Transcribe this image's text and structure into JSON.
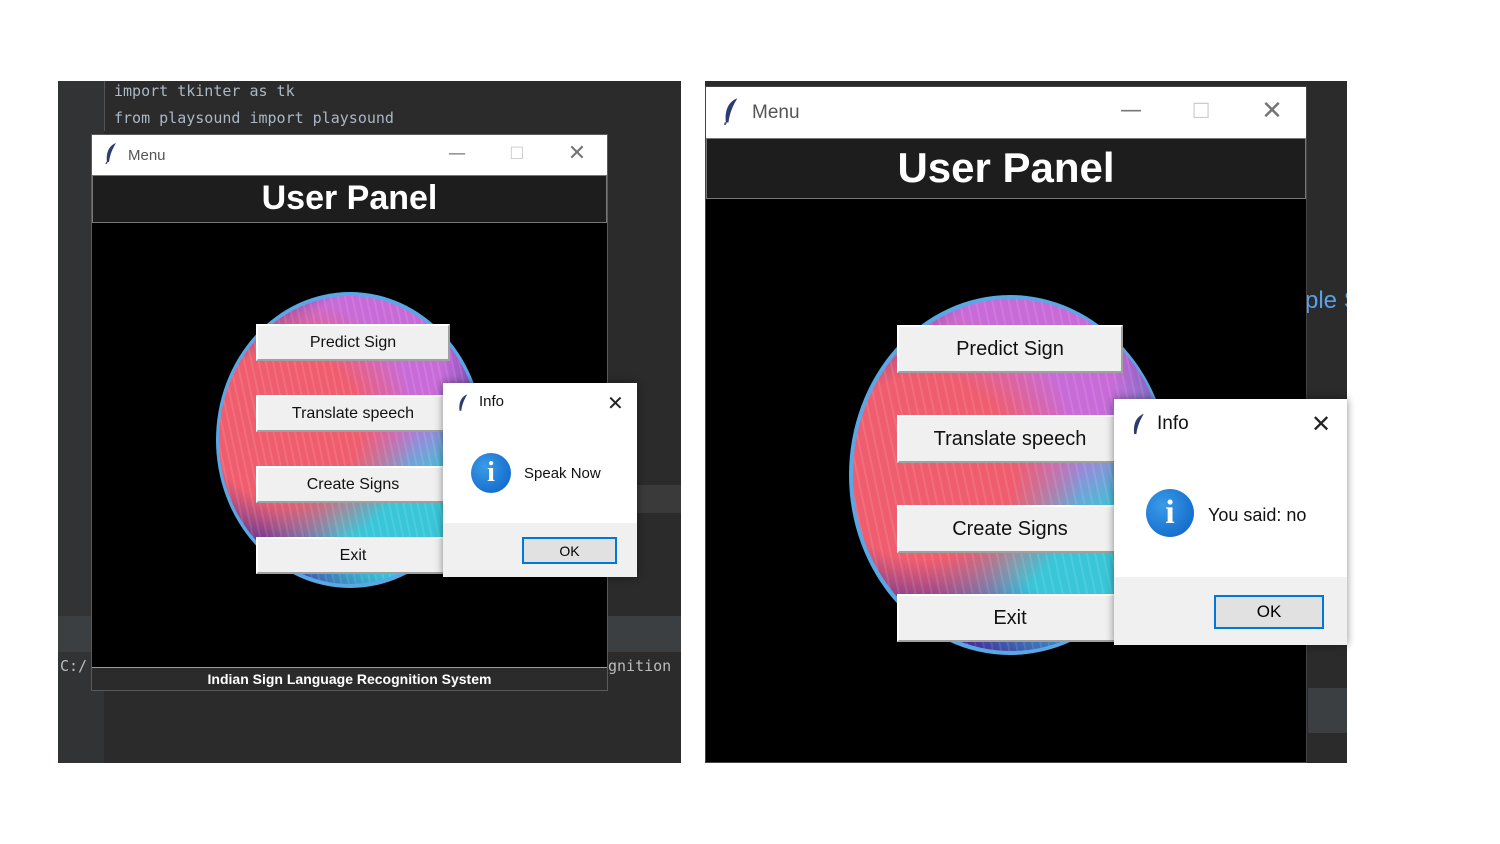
{
  "left": {
    "code_lines": [
      "import tkinter as tk",
      "from playsound import playsound"
    ],
    "terminal_left": "C:/",
    "terminal_right": "gnition",
    "window": {
      "title": "Menu",
      "header": "User Panel",
      "buttons": [
        "Predict Sign",
        "Translate speech",
        "Create Signs",
        "Exit"
      ],
      "footer": "Indian Sign Language Recognition System"
    },
    "dialog": {
      "title": "Info",
      "message": "Speak Now",
      "ok": "OK"
    }
  },
  "right": {
    "side_text": "ple S",
    "window": {
      "title": "Menu",
      "header": "User Panel",
      "buttons": [
        "Predict Sign",
        "Translate speech",
        "Create Signs",
        "Exit"
      ]
    },
    "dialog": {
      "title": "Info",
      "message": "You said: no",
      "ok": "OK"
    }
  },
  "icons": [
    "feather-icon",
    "minimize-icon",
    "maximize-icon",
    "close-icon",
    "info-icon"
  ],
  "colors": {
    "ide_bg": "#2b2b2b",
    "panel_bg": "#000000",
    "header_bg": "#1d1d1d",
    "ok_border": "#0078d7",
    "info_blue": "#1a73d9"
  }
}
